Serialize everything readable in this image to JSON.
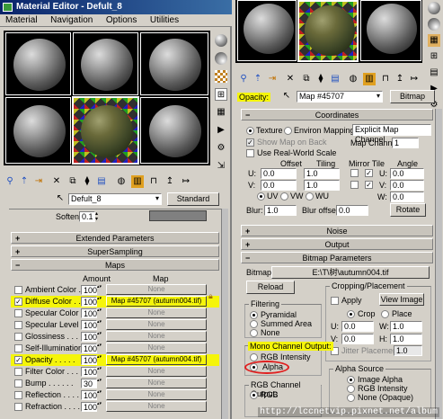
{
  "left": {
    "title": "Material Editor - Defult_8",
    "menu": [
      "Material",
      "Navigation",
      "Options",
      "Utilities"
    ],
    "material_name": "Defult_8",
    "material_type": "Standard",
    "soften_label": "Soften:",
    "soften_value": "0.1",
    "rollouts": [
      "Extended Parameters",
      "SuperSampling",
      "Maps"
    ],
    "maps_header": {
      "amount": "Amount",
      "map": "Map"
    },
    "maps": [
      {
        "label": "Ambient Color . .",
        "amount": "100",
        "map": "None",
        "checked": false,
        "highlight": false
      },
      {
        "label": "Diffuse Color . .",
        "amount": "100",
        "map": "Map #45707 (autumn004.tif)",
        "checked": true,
        "highlight": true
      },
      {
        "label": "Specular Color .",
        "amount": "100",
        "map": "None",
        "checked": false,
        "highlight": false
      },
      {
        "label": "Specular Level .",
        "amount": "100",
        "map": "None",
        "checked": false,
        "highlight": false
      },
      {
        "label": "Glossiness . . .",
        "amount": "100",
        "map": "None",
        "checked": false,
        "highlight": false
      },
      {
        "label": "Self-Illumination .",
        "amount": "100",
        "map": "None",
        "checked": false,
        "highlight": false
      },
      {
        "label": "Opacity . . . . .",
        "amount": "100",
        "map": "Map #45707 (autumn004.tif)",
        "checked": true,
        "highlight": true
      },
      {
        "label": "Filter Color . . .",
        "amount": "100",
        "map": "None",
        "checked": false,
        "highlight": false
      },
      {
        "label": "Bump . . . . . .",
        "amount": "30",
        "map": "None",
        "checked": false,
        "highlight": false
      },
      {
        "label": "Reflection . . . .",
        "amount": "100",
        "map": "None",
        "checked": false,
        "highlight": false
      },
      {
        "label": "Refraction . . . .",
        "amount": "100",
        "map": "None",
        "checked": false,
        "highlight": false
      }
    ]
  },
  "right": {
    "opacity_label": "Opacity:",
    "map_name": "Map #45707",
    "map_type": "Bitmap",
    "coordinates": {
      "title": "Coordinates",
      "texture": "Texture",
      "environ": "Environ",
      "mapping_label": "Mapping:",
      "mapping_value": "Explicit Map Channel",
      "show_map_on_back": "Show Map on Back",
      "map_channel_label": "Map Channel:",
      "map_channel_value": "1",
      "use_real_world": "Use Real-World Scale",
      "col_offset": "Offset",
      "col_tiling": "Tiling",
      "col_mirror_tile": "Mirror Tile",
      "col_angle": "Angle",
      "u_label": "U:",
      "v_label": "V:",
      "w_label": "W:",
      "u_offset": "0.0",
      "v_offset": "0.0",
      "u_tiling": "1.0",
      "v_tiling": "1.0",
      "u_angle": "0.0",
      "v_angle": "0.0",
      "w_angle": "0.0",
      "uv": "UV",
      "vw": "VW",
      "wu": "WU",
      "blur_label": "Blur:",
      "blur_value": "1.0",
      "blur_offset_label": "Blur offset:",
      "blur_offset_value": "0.0",
      "rotate": "Rotate"
    },
    "rollouts": [
      "Noise",
      "Output",
      "Bitmap Parameters"
    ],
    "bitmap_label": "Bitmap:",
    "bitmap_path": "E:\\T\\树\\autumn004.tif",
    "reload": "Reload",
    "cropping": {
      "title": "Cropping/Placement",
      "apply": "Apply",
      "view_image": "View Image",
      "crop": "Crop",
      "place": "Place",
      "u_label": "U:",
      "v_label": "V:",
      "w_label": "W:",
      "h_label": "H:",
      "u_value": "0.0",
      "v_value": "0.0",
      "w_value": "1.0",
      "h_value": "1.0",
      "jitter": "Jitter Placement:",
      "jitter_value": "1.0"
    },
    "filtering": {
      "title": "Filtering",
      "options": [
        "Pyramidal",
        "Summed Area",
        "None"
      ]
    },
    "mono": {
      "title": "Mono Channel Output:",
      "options": [
        "RGB Intensity",
        "Alpha"
      ]
    },
    "rgb_channel": {
      "title": "RGB Channel Output:",
      "option": "RGB"
    },
    "alpha_source": {
      "title": "Alpha Source",
      "options": [
        "Image Alpha",
        "RGB Intensity",
        "None (Opaque)"
      ]
    }
  },
  "watermark": "http://lccnetvip.pixnet.net/album",
  "colors": {
    "highlight": "#f5f50a",
    "circle": "#e02020",
    "title_bar": "#0a246a"
  }
}
